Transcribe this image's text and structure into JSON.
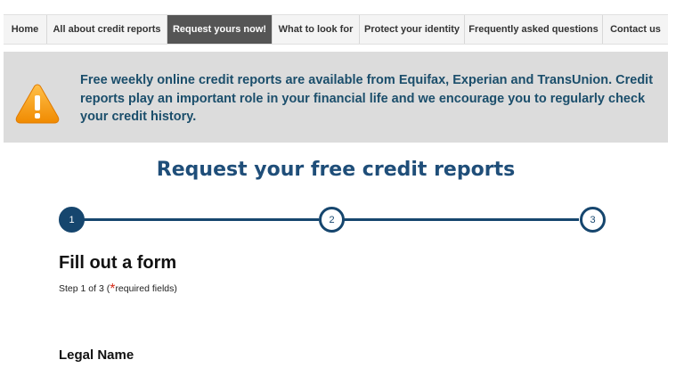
{
  "nav": {
    "items": [
      {
        "label": "Home",
        "active": false
      },
      {
        "label": "All about credit reports",
        "active": false
      },
      {
        "label": "Request yours now!",
        "active": true
      },
      {
        "label": "What to look for",
        "active": false
      },
      {
        "label": "Protect your identity",
        "active": false
      },
      {
        "label": "Frequently asked questions",
        "active": false
      },
      {
        "label": "Contact us",
        "active": false
      }
    ]
  },
  "alert": {
    "icon": "warning-icon",
    "text": "Free weekly online credit reports are available from Equifax, Experian and TransUnion. Credit reports play an important role in your financial life and we encourage you to regularly check your credit history."
  },
  "page": {
    "title": "Request your free credit reports"
  },
  "stepper": {
    "steps": [
      "1",
      "2",
      "3"
    ],
    "current": 1
  },
  "form": {
    "title": "Fill out a form",
    "step_prefix": "Step 1 of 3 (",
    "required_mark": "*",
    "step_suffix": "required fields)",
    "section_label": "Legal Name"
  },
  "colors": {
    "primary": "#16466e",
    "alert_text": "#1b4e6b",
    "alert_bg": "#dcdcdc",
    "nav_active": "#555555",
    "required": "#d62c1a",
    "warning": "#f5a623"
  }
}
